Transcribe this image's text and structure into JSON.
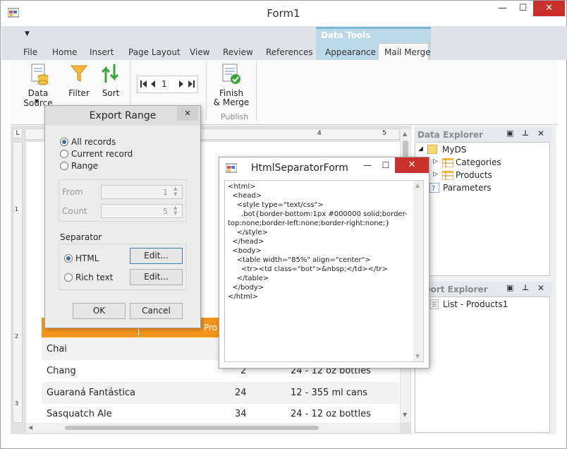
{
  "window": {
    "title": "Form1",
    "min": "—",
    "max": "☐",
    "close": "✕",
    "qat_arrow": "▼"
  },
  "ribbon": {
    "tabs": [
      "File",
      "Home",
      "Insert",
      "Page Layout",
      "View",
      "Review",
      "References"
    ],
    "context_header": "Data Tools",
    "context_tabs": [
      "Appearance",
      "Mail Merge"
    ],
    "buttons": {
      "data_source": "Data Source",
      "filter": "Filter",
      "sort": "Sort",
      "record_value": "1",
      "finish_merge_1": "Finish",
      "finish_merge_2": "& Merge",
      "group_publish": "Publish"
    }
  },
  "export_range": {
    "title": "Export Range",
    "close": "✕",
    "opt_all": "All records",
    "opt_current": "Current record",
    "opt_range": "Range",
    "from_label": "From",
    "from_value": "1",
    "count_label": "Count",
    "count_value": "5",
    "separator_label": "Separator",
    "html_label": "HTML",
    "rich_label": "Rich text",
    "edit1": "Edit...",
    "edit2": "Edit...",
    "ok": "OK",
    "cancel": "Cancel"
  },
  "html_sep": {
    "title": "HtmlSeparatorForm",
    "min": "—",
    "max": "☐",
    "close": "✕",
    "code": "<html>\n  <head>\n    <style type=\"text/css\">\n      .bot{border-bottom:1px #000000 solid;border-top:none;border-left:none;border-right:none;}\n    </style>\n  </head>\n  <body>\n    <table width=\"85%\" align=\"center\">\n      <tr><td class=\"bot\">&nbsp;</td></tr>\n    </table>\n  </body>\n</html>"
  },
  "data_explorer": {
    "title": "Data Explorer",
    "root": "MyDS",
    "items": [
      "Categories",
      "Products",
      "Parameters"
    ]
  },
  "report_explorer": {
    "title": "Report Explorer",
    "visible_title": "port Explorer",
    "item": "List - Products1"
  },
  "document": {
    "header_partial": "Pro",
    "rows": [
      {
        "name": "Chai",
        "qty": "",
        "unit": ""
      },
      {
        "name": "Chang",
        "qty": "2",
        "unit": "24 - 12 oz bottles"
      },
      {
        "name": "Guaraná Fantástica",
        "qty": "24",
        "unit": "12 - 355 ml cans"
      },
      {
        "name": "Sasquatch Ale",
        "qty": "34",
        "unit": "24 - 12 oz bottles"
      }
    ],
    "ruler_marks": [
      "4",
      "5"
    ],
    "vruler_marks": [
      "1",
      "2",
      "3"
    ]
  },
  "colors": {
    "accent_orange": "#f7941d",
    "context_tab": "#bcd9ea",
    "close_red": "#c9302c",
    "row_alt": "#f2f2f2"
  }
}
